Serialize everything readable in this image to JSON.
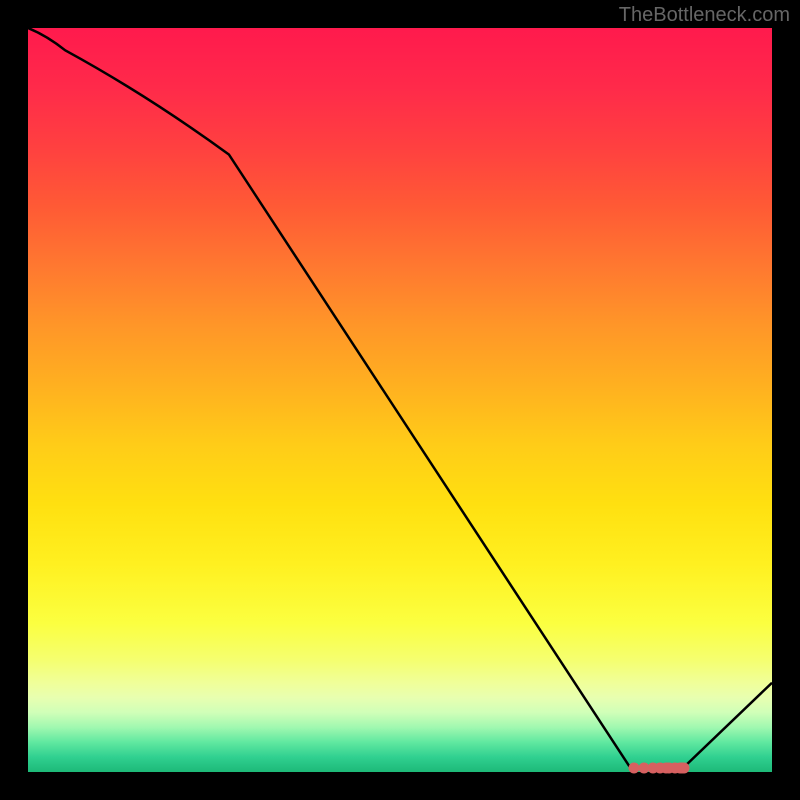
{
  "watermark": "TheBottleneck.com",
  "chart_data": {
    "type": "line",
    "title": "",
    "xlabel": "",
    "ylabel": "",
    "xlim": [
      0,
      100
    ],
    "ylim": [
      0,
      100
    ],
    "x": [
      0,
      5,
      27,
      81,
      88,
      100
    ],
    "values": [
      100,
      97,
      83,
      0.5,
      0.5,
      12
    ],
    "markers": {
      "description": "cluster of points near global minimum",
      "x": [
        81.5,
        82.8,
        84.0,
        84.9,
        85.8,
        86.2,
        87.0,
        87.6,
        87.9,
        88.2
      ],
      "y": [
        0.5,
        0.5,
        0.5,
        0.5,
        0.6,
        0.5,
        0.5,
        0.6,
        0.6,
        0.5
      ]
    },
    "background_gradient": {
      "top": "#ff1a4d",
      "middle": "#ffe010",
      "bottom": "#1db978"
    }
  }
}
